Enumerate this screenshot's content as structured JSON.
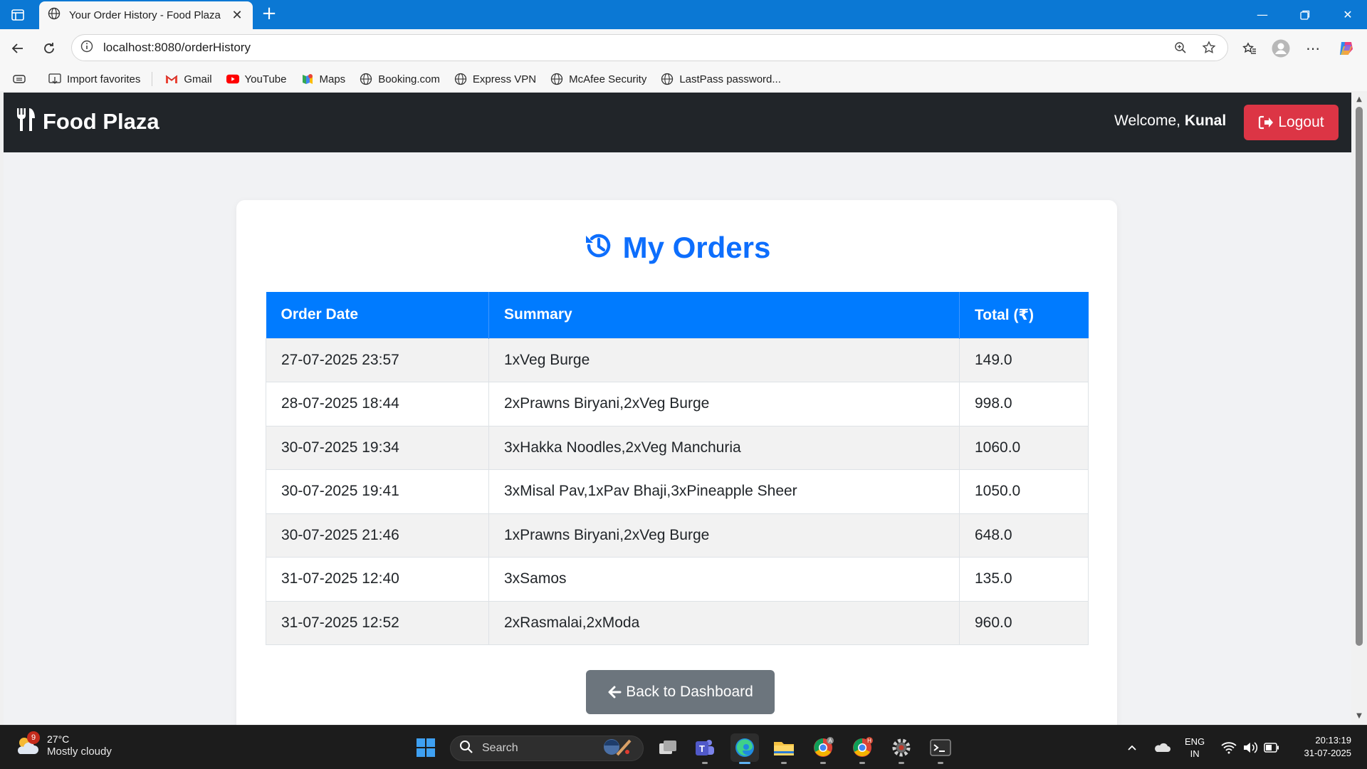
{
  "browser": {
    "tab_title": "Your Order History - Food Plaza",
    "url": "localhost:8080/orderHistory",
    "favorites": [
      {
        "label": "Import favorites",
        "icon": "import-icon"
      },
      {
        "label": "Gmail",
        "icon": "gmail-icon"
      },
      {
        "label": "YouTube",
        "icon": "youtube-icon"
      },
      {
        "label": "Maps",
        "icon": "maps-icon"
      },
      {
        "label": "Booking.com",
        "icon": "globe-icon"
      },
      {
        "label": "Express VPN",
        "icon": "globe-icon"
      },
      {
        "label": "McAfee Security",
        "icon": "globe-icon"
      },
      {
        "label": "LastPass password...",
        "icon": "globe-icon"
      }
    ]
  },
  "navbar": {
    "brand": "Food Plaza",
    "welcome_prefix": "Welcome,",
    "username": "Kunal",
    "logout_label": "Logout"
  },
  "page": {
    "heading": "My Orders",
    "columns": [
      "Order Date",
      "Summary",
      "Total (₹)"
    ],
    "orders": [
      {
        "date": "27-07-2025 23:57",
        "summary": "1xVeg Burge",
        "total": "149.0"
      },
      {
        "date": "28-07-2025 18:44",
        "summary": "2xPrawns Biryani,2xVeg Burge",
        "total": "998.0"
      },
      {
        "date": "30-07-2025 19:34",
        "summary": "3xHakka Noodles,2xVeg Manchuria",
        "total": "1060.0"
      },
      {
        "date": "30-07-2025 19:41",
        "summary": "3xMisal Pav,1xPav Bhaji,3xPineapple Sheer",
        "total": "1050.0"
      },
      {
        "date": "30-07-2025 21:46",
        "summary": "1xPrawns Biryani,2xVeg Burge",
        "total": "648.0"
      },
      {
        "date": "31-07-2025 12:40",
        "summary": "3xSamos",
        "total": "135.0"
      },
      {
        "date": "31-07-2025 12:52",
        "summary": "2xRasmalai,2xModa",
        "total": "960.0"
      }
    ],
    "back_label": "Back to Dashboard"
  },
  "taskbar": {
    "weather_temp": "27°C",
    "weather_cond": "Mostly cloudy",
    "weather_badge": "9",
    "search_placeholder": "Search",
    "lang_top": "ENG",
    "lang_bottom": "IN",
    "time": "20:13:19",
    "date": "31-07-2025"
  },
  "colors": {
    "navbar_bg": "#212529",
    "primary": "#0d6efd",
    "table_header": "#007bff",
    "logout": "#dc3545",
    "back_button": "#6c757d",
    "browser_accent": "#0b78d4"
  }
}
